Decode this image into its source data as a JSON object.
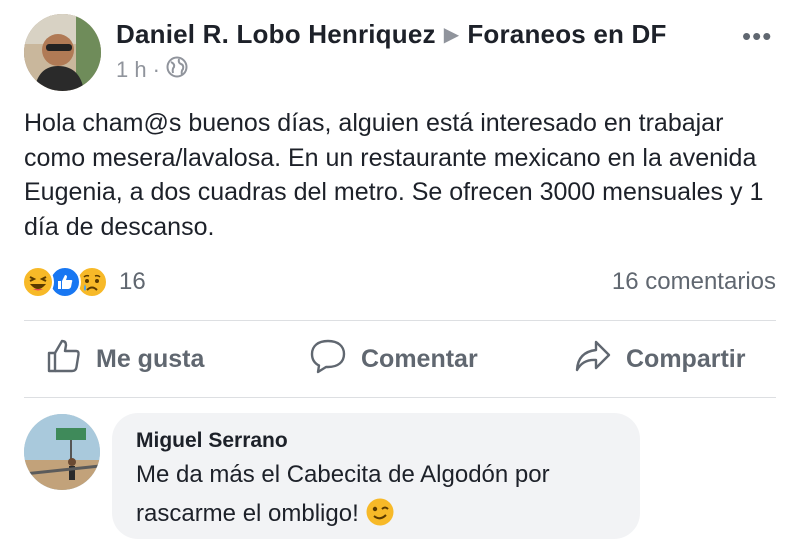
{
  "post": {
    "author": "Daniel R. Lobo Henriquez",
    "group": "Foraneos en DF",
    "time": "1 h",
    "privacy_icon": "globe-icon",
    "body": "Hola cham@s buenos días, alguien está interesado en trabajar como mesera/lavalosa. En un restaurante mexicano en la avenida Eugenia, a dos cuadras del metro. Se ofrecen 3000 mensuales y 1 día de descanso.",
    "more_icon": "more-dots-icon"
  },
  "reactions": {
    "icons": [
      "haha-icon",
      "like-icon",
      "sad-icon"
    ],
    "count": "16",
    "comments": "16 comentarios"
  },
  "actions": {
    "like": "Me gusta",
    "comment": "Comentar",
    "share": "Compartir"
  },
  "comment": {
    "author": "Miguel Serrano",
    "text": "Me da más el Cabecita de Algodón por rascarme el ombligo!",
    "emoji_icon": "wink-emoji-icon"
  },
  "colors": {
    "secondary_text": "#606770",
    "meta_text": "#90949c",
    "like_blue": "#1877f2",
    "reaction_yellow": "#f7b928",
    "bubble_bg": "#f2f3f5"
  }
}
